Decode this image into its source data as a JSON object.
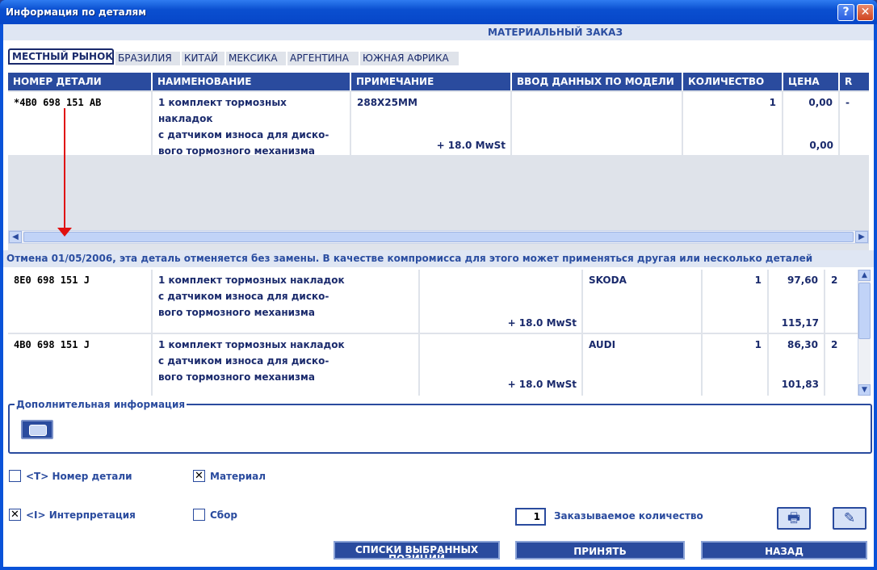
{
  "window": {
    "title": "Информация по деталям",
    "help_label": "?",
    "close_label": "✕"
  },
  "section_title": "МАТЕРИАЛЬНЫЙ ЗАКАЗ",
  "tabs": [
    "МЕСТНЫЙ РЫНОК",
    "БРАЗИЛИЯ",
    "КИТАЙ",
    "МЕКСИКА",
    "АРГЕНТИНА",
    "ЮЖНАЯ АФРИКА"
  ],
  "table": {
    "headers": [
      "НОМЕР ДЕТАЛИ",
      "НАИМЕНОВАНИЕ",
      "ПРИМЕЧАНИЕ",
      "ВВОД ДАННЫХ ПО МОДЕЛИ",
      "КОЛИЧЕСТВО",
      "ЦЕНА",
      "R"
    ],
    "rows": [
      {
        "part_number": "*4B0 698 151 AB",
        "name_lines": [
          "1 комплект тормозных накладок",
          "с датчиком износа для диско-",
          "вого тормозного механизма"
        ],
        "note": "288X25MM",
        "vat": "+ 18.0 MwSt",
        "model": "",
        "quantity": "1",
        "price": "0,00",
        "price_gross": "0,00",
        "r": "-"
      }
    ]
  },
  "notice": "Отмена 01/05/2006, эта деталь отменяется без замены. В качестве компромисса для этого может применяться другая или несколько деталей",
  "replacements": [
    {
      "part_number": "8E0 698 151 J",
      "name_lines": [
        "1 комплект тормозных накладок",
        "с датчиком износа для диско-",
        "вого тормозного механизма"
      ],
      "vat": "+ 18.0 MwSt",
      "brand": "SKODA",
      "quantity": "1",
      "price": "97,60",
      "price_gross": "115,17",
      "r": "2"
    },
    {
      "part_number": "4B0 698 151 J",
      "name_lines": [
        "1 комплект тормозных накладок",
        "с датчиком износа для диско-",
        "вого тормозного механизма"
      ],
      "vat": "+ 18.0 MwSt",
      "brand": "AUDI",
      "quantity": "1",
      "price": "86,30",
      "price_gross": "101,83",
      "r": "2"
    }
  ],
  "additional_info": {
    "legend": "Дополнительная информация"
  },
  "options": {
    "part_number": {
      "label": "<T> Номер детали",
      "checked": false
    },
    "material": {
      "label": "Материал",
      "checked": true
    },
    "interpretation": {
      "label": "<I> Интерпретация",
      "checked": true
    },
    "assembly": {
      "label": "Сбор",
      "checked": false
    }
  },
  "order_qty": {
    "value": "1",
    "label": "Заказываемое количество"
  },
  "buttons": {
    "lists": "СПИСКИ ВЫБРАННЫХ ПОЗИЦИЙ",
    "accept": "ПРИНЯТЬ",
    "back": "НАЗАД"
  },
  "colors": {
    "header_blue": "#2a4b9e",
    "title_blue": "#0a52d8",
    "arrow_red": "#e01010"
  }
}
